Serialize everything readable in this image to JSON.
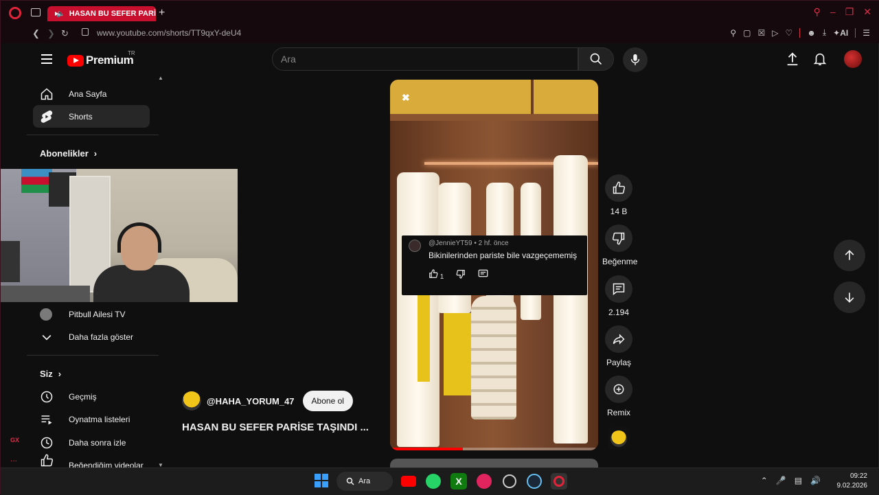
{
  "browser": {
    "tab_title": "HASAN BU SEFER PARİ",
    "url": "www.youtube.com/shorts/TT9qxY-deU4",
    "ai_label": "AI",
    "gx_label": "GX",
    "dots_label": "..."
  },
  "header": {
    "logo_text": "Premium",
    "region": "TR",
    "search_placeholder": "Ara"
  },
  "sidebar": {
    "items_top": [
      {
        "label": "Ana Sayfa"
      },
      {
        "label": "Shorts"
      }
    ],
    "subscriptions_heading": "Abonelikler",
    "subscription_items": [
      {
        "label": "Pitbull Ailesi TV"
      },
      {
        "label": "Daha fazla göster"
      }
    ],
    "you_heading": "Siz",
    "you_items": [
      {
        "label": "Geçmiş"
      },
      {
        "label": "Oynatma listeleri"
      },
      {
        "label": "Daha sonra izle"
      },
      {
        "label": "Beğendiğim videolar"
      }
    ]
  },
  "short": {
    "comment_user": "@JennieYT59",
    "comment_time": "• 2 hf. önce",
    "comment_text": "Bikinilerinden pariste bile vazgeçememiş",
    "comment_likes": "1",
    "channel": "@HAHA_YORUM_47",
    "subscribe_label": "Abone ol",
    "title": "HASAN BU SEFER PARİSE TAŞINDI ...",
    "progress_fraction": 0.35
  },
  "actions": {
    "like_count": "14 B",
    "dislike_label": "Beğenme",
    "comments_count": "2.194",
    "share_label": "Paylaş",
    "remix_label": "Remix"
  },
  "taskbar": {
    "search_label": "Ara",
    "time": "09:22",
    "date": "9.02.2026"
  },
  "colors": {
    "accent_red": "#ff0000",
    "opera_red": "#d9304a",
    "background": "#0f0f0f"
  }
}
